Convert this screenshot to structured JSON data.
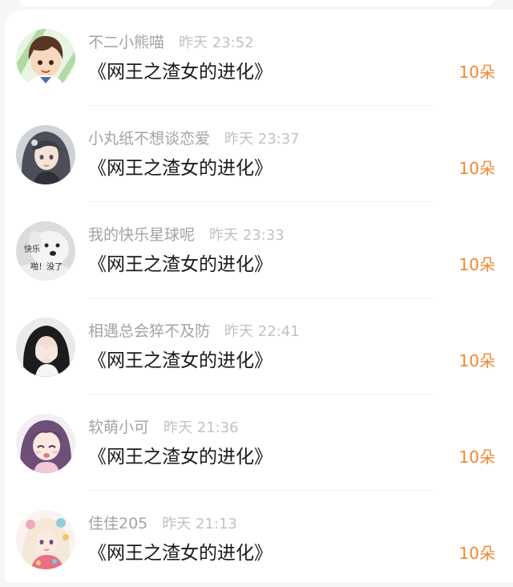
{
  "colors": {
    "background": "#f6f6f6",
    "card": "#ffffff",
    "name": "#a3a3a3",
    "time": "#c2c2c2",
    "title": "#1a1a1a",
    "count": "#f08a2c"
  },
  "entries": [
    {
      "user": "不二小熊喵",
      "time": "昨天 23:52",
      "book": "《网王之渣女的进化》",
      "count": "10朵",
      "avatar": "avatar-boy-cartoon"
    },
    {
      "user": "小丸纸不想谈恋爱",
      "time": "昨天 23:37",
      "book": "《网王之渣女的进化》",
      "count": "10朵",
      "avatar": "avatar-anime-girl"
    },
    {
      "user": "我的快乐星球呢",
      "time": "昨天 23:33",
      "book": "《网王之渣女的进化》",
      "count": "10朵",
      "avatar": "avatar-dog-meme"
    },
    {
      "user": "相遇总会猝不及防",
      "time": "昨天 22:41",
      "book": "《网王之渣女的进化》",
      "count": "10朵",
      "avatar": "avatar-girl-photo"
    },
    {
      "user": "软萌小可",
      "time": "昨天 21:36",
      "book": "《网王之渣女的进化》",
      "count": "10朵",
      "avatar": "avatar-anime-purple"
    },
    {
      "user": "佳佳205",
      "time": "昨天 21:13",
      "book": "《网王之渣女的进化》",
      "count": "10朵",
      "avatar": "avatar-colorful-girl"
    }
  ],
  "avatar_captions": {
    "dog_line1": "快乐",
    "dog_line2": "啪！没了"
  }
}
